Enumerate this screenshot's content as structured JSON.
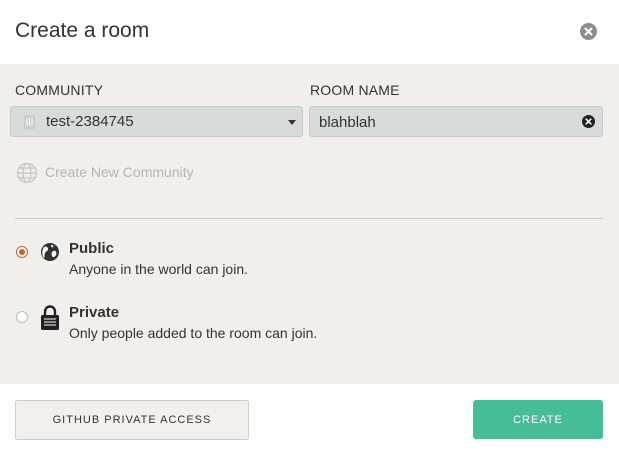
{
  "dialog": {
    "title": "Create a room"
  },
  "community": {
    "label": "COMMUNITY",
    "selected": "test-2384745"
  },
  "room_name": {
    "label": "ROOM NAME",
    "value": "blahblah"
  },
  "create_community": {
    "label": "Create New Community"
  },
  "visibility": {
    "public": {
      "title": "Public",
      "description": "Anyone in the world can join.",
      "checked": true
    },
    "private": {
      "title": "Private",
      "description": "Only people added to the room can join.",
      "checked": false
    }
  },
  "footer": {
    "github_label": "GITHUB PRIVATE ACCESS",
    "create_label": "CREATE"
  },
  "colors": {
    "accent": "#46bc99",
    "radio_selected": "#d2602f",
    "panel_bg": "#f0efeb"
  },
  "icons": {
    "close": "close-icon",
    "community_avatar": "community-avatar-icon",
    "dropdown": "chevron-down-icon",
    "clear": "clear-icon",
    "globe": "globe-icon",
    "earth": "earth-icon",
    "lock": "lock-icon"
  }
}
